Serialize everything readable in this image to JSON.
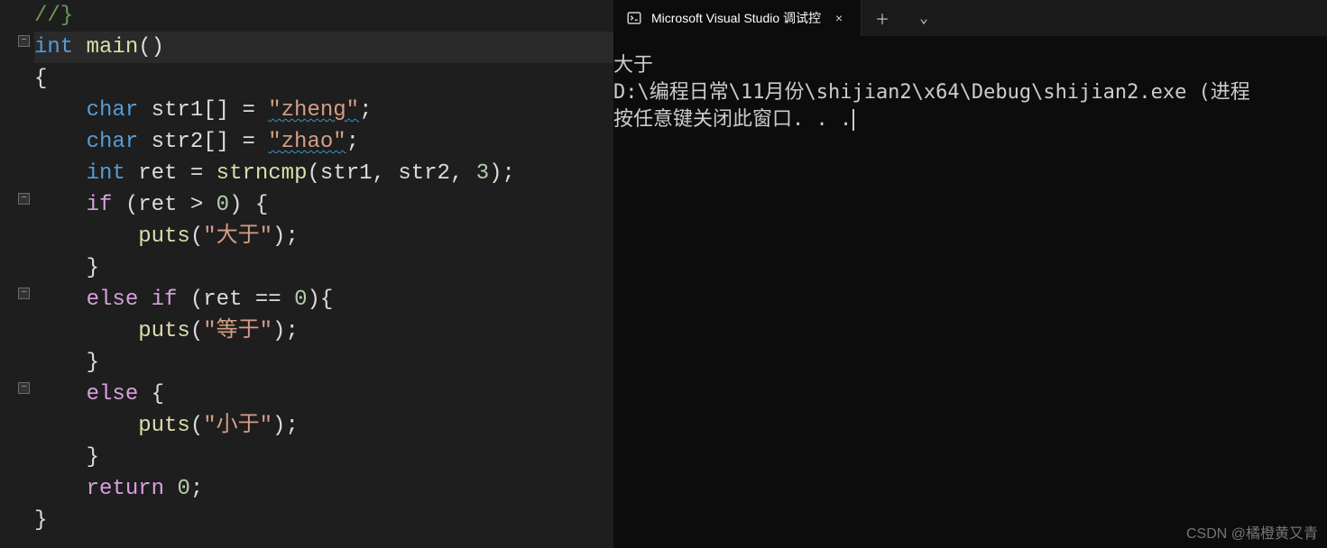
{
  "editor": {
    "lines": [
      {
        "raw": "//}",
        "type": "comment"
      },
      {
        "raw": "int main()",
        "tokens": [
          [
            "k-type",
            "int"
          ],
          [
            "k-punc",
            " "
          ],
          [
            "k-func",
            "main"
          ],
          [
            "k-punc",
            "()"
          ]
        ],
        "highlighted": true,
        "fold": true
      },
      {
        "raw": "{",
        "tokens": [
          [
            "k-punc",
            "{"
          ]
        ]
      },
      {
        "raw": "    char str1[] = \"zheng\";",
        "tokens": [
          [
            "k-punc",
            "    "
          ],
          [
            "k-type",
            "char"
          ],
          [
            "k-punc",
            " "
          ],
          [
            "k-ident",
            "str1"
          ],
          [
            "k-punc",
            "[] = "
          ],
          [
            "k-string squiggle",
            "\"zheng\""
          ],
          [
            "k-punc",
            ";"
          ]
        ]
      },
      {
        "raw": "    char str2[] = \"zhao\";",
        "tokens": [
          [
            "k-punc",
            "    "
          ],
          [
            "k-type",
            "char"
          ],
          [
            "k-punc",
            " "
          ],
          [
            "k-ident",
            "str2"
          ],
          [
            "k-punc",
            "[] = "
          ],
          [
            "k-string squiggle",
            "\"zhao\""
          ],
          [
            "k-punc",
            ";"
          ]
        ]
      },
      {
        "raw": "    int ret = strncmp(str1, str2, 3);",
        "tokens": [
          [
            "k-punc",
            "    "
          ],
          [
            "k-type",
            "int"
          ],
          [
            "k-punc",
            " "
          ],
          [
            "k-ident",
            "ret"
          ],
          [
            "k-punc",
            " = "
          ],
          [
            "k-func",
            "strncmp"
          ],
          [
            "k-punc",
            "("
          ],
          [
            "k-ident",
            "str1"
          ],
          [
            "k-punc",
            ", "
          ],
          [
            "k-ident",
            "str2"
          ],
          [
            "k-punc",
            ", "
          ],
          [
            "k-number",
            "3"
          ],
          [
            "k-punc",
            ");"
          ]
        ]
      },
      {
        "raw": "    if (ret > 0) {",
        "tokens": [
          [
            "k-punc",
            "    "
          ],
          [
            "k-keyword",
            "if"
          ],
          [
            "k-punc",
            " ("
          ],
          [
            "k-ident",
            "ret"
          ],
          [
            "k-punc",
            " > "
          ],
          [
            "k-number",
            "0"
          ],
          [
            "k-punc",
            ") {"
          ]
        ],
        "fold": true
      },
      {
        "raw": "        puts(\"大于\");",
        "tokens": [
          [
            "k-punc",
            "        "
          ],
          [
            "k-func",
            "puts"
          ],
          [
            "k-punc",
            "("
          ],
          [
            "k-string",
            "\"大于\""
          ],
          [
            "k-punc",
            ");"
          ]
        ]
      },
      {
        "raw": "    }",
        "tokens": [
          [
            "k-punc",
            "    }"
          ]
        ]
      },
      {
        "raw": "    else if (ret == 0){",
        "tokens": [
          [
            "k-punc",
            "    "
          ],
          [
            "k-keyword",
            "else if"
          ],
          [
            "k-punc",
            " ("
          ],
          [
            "k-ident",
            "ret"
          ],
          [
            "k-punc",
            " == "
          ],
          [
            "k-number",
            "0"
          ],
          [
            "k-punc",
            "){"
          ]
        ],
        "fold": true
      },
      {
        "raw": "        puts(\"等于\");",
        "tokens": [
          [
            "k-punc",
            "        "
          ],
          [
            "k-func",
            "puts"
          ],
          [
            "k-punc",
            "("
          ],
          [
            "k-string",
            "\"等于\""
          ],
          [
            "k-punc",
            ");"
          ]
        ]
      },
      {
        "raw": "    }",
        "tokens": [
          [
            "k-punc",
            "    }"
          ]
        ]
      },
      {
        "raw": "    else {",
        "tokens": [
          [
            "k-punc",
            "    "
          ],
          [
            "k-keyword",
            "else"
          ],
          [
            "k-punc",
            " {"
          ]
        ],
        "fold": true
      },
      {
        "raw": "        puts(\"小于\");",
        "tokens": [
          [
            "k-punc",
            "        "
          ],
          [
            "k-func",
            "puts"
          ],
          [
            "k-punc",
            "("
          ],
          [
            "k-string",
            "\"小于\""
          ],
          [
            "k-punc",
            ");"
          ]
        ]
      },
      {
        "raw": "    }",
        "tokens": [
          [
            "k-punc",
            "    }"
          ]
        ]
      },
      {
        "raw": "    return 0;",
        "tokens": [
          [
            "k-punc",
            "    "
          ],
          [
            "k-keyword",
            "return"
          ],
          [
            "k-punc",
            " "
          ],
          [
            "k-number",
            "0"
          ],
          [
            "k-punc",
            ";"
          ]
        ]
      },
      {
        "raw": "}",
        "tokens": [
          [
            "k-punc",
            "}"
          ]
        ]
      }
    ]
  },
  "terminal": {
    "tab_title": "Microsoft Visual Studio 调试控",
    "output": [
      "大于",
      "",
      "D:\\编程日常\\11月份\\shijian2\\x64\\Debug\\shijian2.exe (进程",
      "按任意键关闭此窗口. . ."
    ]
  },
  "watermark": "CSDN @橘橙黄又青",
  "icons": {
    "new_tab": "＋",
    "dropdown": "⌄",
    "close": "×",
    "fold_minus": "−"
  }
}
